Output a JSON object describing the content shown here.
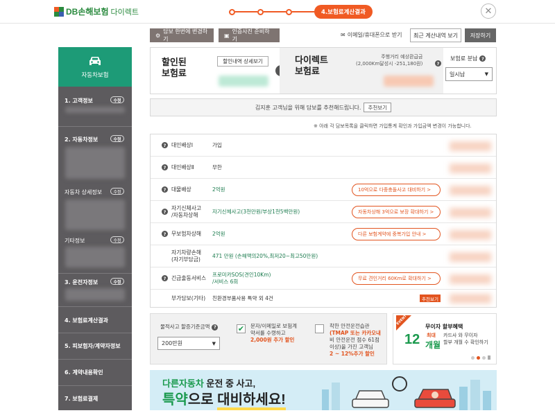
{
  "header": {
    "logo_db": "DB손해보험",
    "logo_direct": "다이렉트",
    "current_step": "4.보험료계산결과",
    "close_label": "✕"
  },
  "toolbar": {
    "change_coverage": "담보 한번에 변경하기",
    "photo_prepare": "인증사진 준비하기",
    "email_receive": "이메일/휴대폰으로 받기",
    "recent_calc": "최근 계산내역 보기",
    "save": "저장하기"
  },
  "sidebar": {
    "title": "자동차보험",
    "items": [
      {
        "label": "1. 고객정보",
        "badge": "수정"
      },
      {
        "label": "2. 자동차정보",
        "badge": "수정"
      },
      {
        "label": "자동차 상세정보",
        "badge": "수정"
      },
      {
        "label": "기타정보",
        "badge": "수정"
      },
      {
        "label": "3. 운전자정보",
        "badge": "수정"
      },
      {
        "label": "4. 보험료계산결과"
      },
      {
        "label": "5. 피보험자/계약자정보"
      },
      {
        "label": "6. 계약내용확인"
      },
      {
        "label": "7. 보험료결제"
      }
    ]
  },
  "summary": {
    "discount_title_1": "할인된",
    "discount_title_2": "보험료",
    "discount_detail_btn": "할인내역 상세보기",
    "direct_title_1": "다이렉트",
    "direct_title_2": "보험료",
    "mileage_note_1": "주행거리 예상환급금",
    "mileage_note_2": "(2,000Km달성시 -251,180원)",
    "pay_split_label": "보험료 분납",
    "pay_split_value": "일시납"
  },
  "recommend": {
    "text": "김지훈 고객님을 위해 담보를 추천해드립니다.",
    "button": "추천보기"
  },
  "info_note": "※ 아래 각 담보목록을 클릭하면 가입통계 확인과 가입금액 변경이 가능합니다.",
  "coverage": [
    {
      "name": "대인배상Ⅰ",
      "value": "가입"
    },
    {
      "name": "대인배상Ⅱ",
      "value": "무한"
    },
    {
      "name": "대물배상",
      "value": "2억원",
      "pill": "10억으로 다중충돌사고 대비하기 >"
    },
    {
      "name": "자기신체사고/자동차상해",
      "name1": "자기신체사고",
      "name2": "/자동차상해",
      "value": "자기신체사고(3천만원/부상1천5백만원)",
      "pill": "자동차상해 3억으로 보장 확대하기 >"
    },
    {
      "name": "무보험차상해",
      "value": "2억원",
      "pill": "다른 보험계약에 중복가입 안내 >"
    },
    {
      "name1": "자기차량손해",
      "name2": "(자기부담금)",
      "value": "471 만원 (손해액의20%,최저20~최고50만원)"
    },
    {
      "name": "긴급출동서비스",
      "value1": "프로미카SOS(견인10Km)",
      "value2": "/서비스 6회",
      "pill": "무료 견인거리 60Km로 확대하기 >"
    },
    {
      "name": "부가담보(기타)",
      "value": "친환경부품사용 특약 외 4건",
      "tag": "추천보기"
    }
  ],
  "options": {
    "property_label": "물적사고 할증기준금액",
    "property_value": "200만원",
    "opt1_line1": "문자/이메일로 보험계",
    "opt1_line2": "약서를 수령하고",
    "opt1_line3": "2,000원 추가 할인",
    "opt2_line1": "착한 안전운전습관",
    "opt2_line2": "(TMAP 또는 카카오내",
    "opt2_line3": "비 안전운전 점수 61점",
    "opt2_line4": "이상)을 가진 고객님",
    "opt2_line5": "2 ~ 12%추가 할인"
  },
  "event": {
    "flag": "EVENT",
    "title": "무이자 할부혜택",
    "big_num": "12",
    "small_1": "최대",
    "small_2": "개월",
    "desc_1": "카드사 와 무이자",
    "desc_2": "할부 개월 수 확인하기"
  },
  "banner": {
    "line1_a": "다른자동차",
    "line1_b": " 운전 중 사고,",
    "line2_a": "특약",
    "line2_b": "으로 ",
    "line2_c": "대비하세요!"
  },
  "colors": {
    "brand_green": "#1d9b77",
    "accent_orange": "#f05a23",
    "sidebar_gray": "#5d5b5e"
  }
}
